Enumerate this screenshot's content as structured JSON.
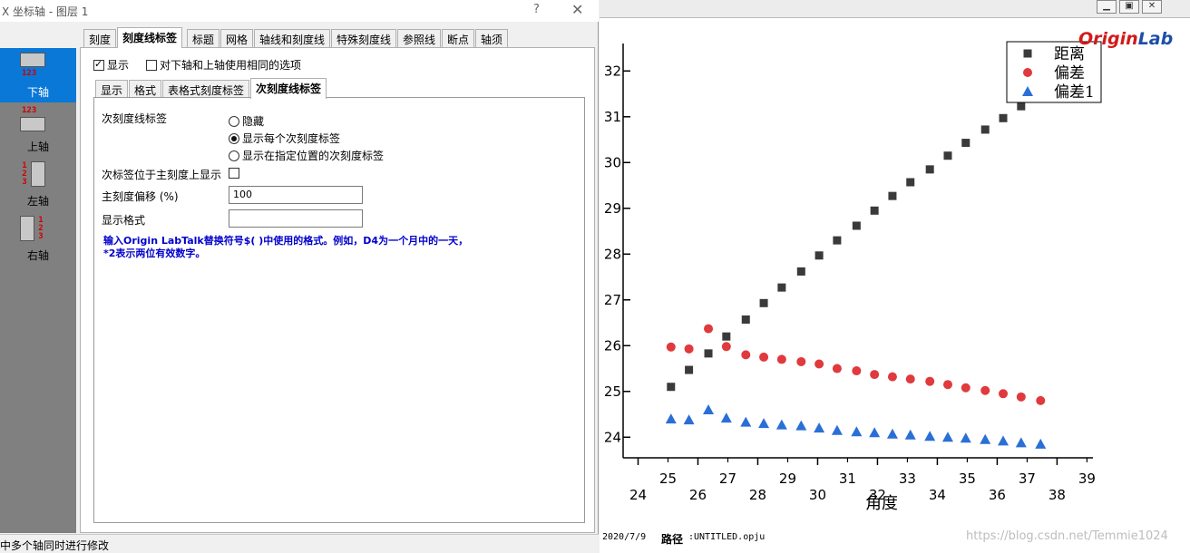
{
  "dialog": {
    "title": "X 坐标轴 - 图层 1",
    "help": "?",
    "close": "✕"
  },
  "axes": [
    {
      "label": "下轴",
      "digits": "123"
    },
    {
      "label": "上轴",
      "digits": "123"
    },
    {
      "label": "左轴",
      "digits": "1 2 3"
    },
    {
      "label": "右轴",
      "digits": "1 2 3"
    }
  ],
  "tabs": [
    "刻度",
    "刻度线标签",
    "标题",
    "网格",
    "轴线和刻度线",
    "特殊刻度线",
    "参照线",
    "断点",
    "轴须"
  ],
  "show_checkbox": "显示",
  "same_options_checkbox": "对下轴和上轴使用相同的选项",
  "inner_tabs": [
    "显示",
    "格式",
    "表格式刻度标签",
    "次刻度线标签"
  ],
  "minor": {
    "label": "次刻度线标签",
    "options": [
      "隐藏",
      "显示每个次刻度标签",
      "显示在指定位置的次刻度标签"
    ],
    "at_major_label": "次标签位于主刻度上显示",
    "offset_label": "主刻度偏移 (%)",
    "offset_value": "100",
    "format_label": "显示格式",
    "format_value": "",
    "hint_line1": "输入Origin LabTalk替换符号$( )中使用的格式。例如，D4为一个月中的一天，",
    "hint_line2": "*2表示两位有效数字。"
  },
  "statusbar": "中多个轴同时进行修改",
  "graph": {
    "logo_origin": "Origin",
    "logo_lab": "Lab",
    "legend": [
      "距离",
      "偏差",
      "偏差1"
    ],
    "xlabel": "角度",
    "date": "2020/7/9",
    "path_label": "路径",
    "path_value": ":UNTITLED.opju",
    "watermark": "https://blog.csdn.net/Temmie1024"
  },
  "chart_data": {
    "type": "scatter",
    "xlabel": "角度",
    "major_x_ticks": [
      24,
      26,
      28,
      30,
      32,
      34,
      36,
      38
    ],
    "minor_x_ticks": [
      25,
      27,
      29,
      31,
      33,
      35,
      37,
      39
    ],
    "y_ticks": [
      24,
      25,
      26,
      27,
      28,
      29,
      30,
      31,
      32
    ],
    "y_tick_labels": [
      "24",
      "25",
      "26",
      "27",
      "28",
      "29",
      "30",
      "31",
      "32"
    ],
    "xlim": [
      23.5,
      39.2
    ],
    "ylim": [
      23.55,
      32.6
    ],
    "series": [
      {
        "name": "距离",
        "marker": "square",
        "color": "#3a3a3a",
        "x": [
          25.1,
          25.7,
          26.35,
          26.95,
          27.6,
          28.2,
          28.8,
          29.45,
          30.05,
          30.65,
          31.3,
          31.9,
          32.5,
          33.1,
          33.75,
          34.35,
          34.95,
          35.6,
          36.2,
          36.8,
          37.45
        ],
        "y": [
          25.1,
          25.47,
          25.83,
          26.2,
          26.57,
          26.93,
          27.27,
          27.62,
          27.97,
          28.3,
          28.62,
          28.95,
          29.27,
          29.57,
          29.85,
          30.15,
          30.43,
          30.72,
          30.97,
          31.23,
          31.5
        ]
      },
      {
        "name": "偏差",
        "marker": "circle",
        "color": "#e0393e",
        "x": [
          25.1,
          25.7,
          26.35,
          26.95,
          27.6,
          28.2,
          28.8,
          29.45,
          30.05,
          30.65,
          31.3,
          31.9,
          32.5,
          33.1,
          33.75,
          34.35,
          34.95,
          35.6,
          36.2,
          36.8,
          37.45
        ],
        "y": [
          25.97,
          25.93,
          26.37,
          25.98,
          25.8,
          25.75,
          25.7,
          25.65,
          25.6,
          25.5,
          25.45,
          25.37,
          25.32,
          25.27,
          25.22,
          25.15,
          25.08,
          25.02,
          24.95,
          24.88,
          24.8
        ]
      },
      {
        "name": "偏差1",
        "marker": "triangle",
        "color": "#2a6fd6",
        "x": [
          25.1,
          25.7,
          26.35,
          26.95,
          27.6,
          28.2,
          28.8,
          29.45,
          30.05,
          30.65,
          31.3,
          31.9,
          32.5,
          33.1,
          33.75,
          34.35,
          34.95,
          35.6,
          36.2,
          36.8,
          37.45
        ],
        "y": [
          24.4,
          24.38,
          24.6,
          24.42,
          24.33,
          24.3,
          24.27,
          24.25,
          24.2,
          24.15,
          24.12,
          24.1,
          24.07,
          24.05,
          24.02,
          24.0,
          23.98,
          23.95,
          23.92,
          23.88,
          23.85
        ]
      }
    ]
  },
  "colors": {
    "accent": "#0a78d7",
    "hint": "#0000cc",
    "origin_red": "#d21a1a",
    "origin_blue": "#1b4ea8"
  }
}
